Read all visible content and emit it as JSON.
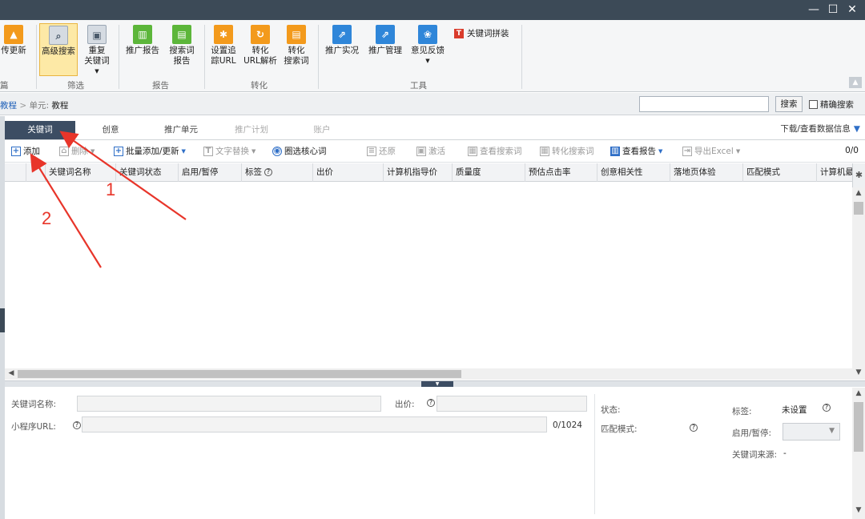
{
  "window": {
    "minimize": "—",
    "maximize": "☐",
    "close": "✕"
  },
  "ribbon": {
    "buttons": {
      "upload": "传更新",
      "advanced_search": "高级搜索",
      "duplicate_line1": "重复",
      "duplicate_line2": "关键词",
      "promo_report": "推广报告",
      "search_report_line1": "搜索词",
      "search_report_line2": "报告",
      "tracking_line1": "设置追",
      "tracking_line2": "踪URL",
      "url_parse_line1": "转化",
      "url_parse_line2": "URL解析",
      "conv_search_line1": "转化",
      "conv_search_line2": "搜索词",
      "promo_live": "推广实况",
      "promo_manage": "推广管理",
      "feedback": "意见反馈",
      "keyword_pin": "关键词拼装"
    },
    "groups": {
      "left_cut": "篇",
      "filter": "筛选",
      "report": "报告",
      "conversion": "转化",
      "tools": "工具"
    }
  },
  "breadcrumb": {
    "first": "教程",
    "separator": ">",
    "unit_label": "单元:",
    "current": "教程"
  },
  "search": {
    "button": "搜索",
    "exact_label": "精确搜索",
    "placeholder": ""
  },
  "tabs": [
    "关键词",
    "创意",
    "推广单元",
    "推广计划",
    "账户"
  ],
  "download_label": "下载/查看数据信息",
  "toolbar": {
    "add": "添加",
    "delete": "删除",
    "batch": "批量添加/更新",
    "replace": "文字替换",
    "core": "圈选核心词",
    "restore": "还原",
    "activate": "激活",
    "view_search": "查看搜索词",
    "conv_search": "转化搜索词",
    "view_report": "查看报告",
    "export": "导出Excel",
    "counter": "0/0"
  },
  "columns": [
    "关键词名称",
    "关键词状态",
    "启用/暂停",
    "标签",
    "出价",
    "计算机指导价",
    "质量度",
    "预估点击率",
    "创意相关性",
    "落地页体验",
    "匹配模式",
    "计算机最"
  ],
  "detail": {
    "keyword_name": "关键词名称:",
    "bid": "出价:",
    "miniprogram_url": "小程序URL:",
    "url_counter": "0/1024",
    "status": "状态:",
    "match_mode": "匹配模式:",
    "tag": "标签:",
    "tag_value": "未设置",
    "enable": "启用/暂停:",
    "source": "关键词来源:",
    "source_value": "-"
  },
  "annotations": {
    "one": "1",
    "two": "2"
  },
  "colors": {
    "accent": "#3c4d63",
    "arrow": "#e8352a",
    "link": "#1d5fb8"
  }
}
